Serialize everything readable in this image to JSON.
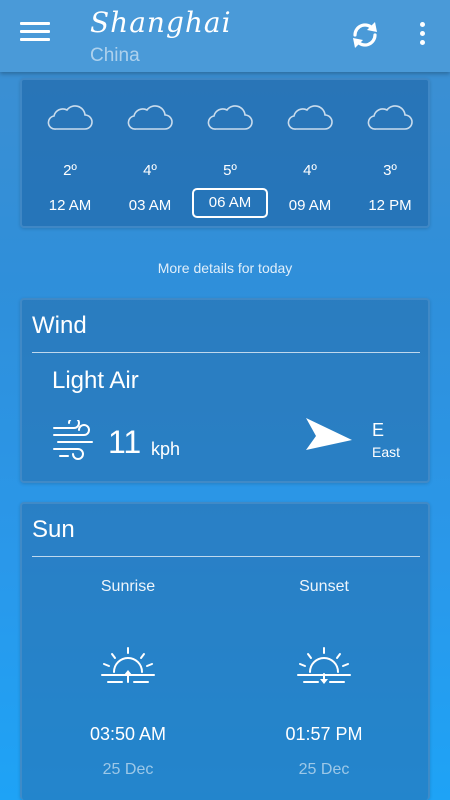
{
  "header": {
    "city": "Shanghai",
    "country": "China"
  },
  "hourly": [
    {
      "temp": "2º",
      "time": "12 AM",
      "icon": "cloud-icon"
    },
    {
      "temp": "4º",
      "time": "03 AM",
      "icon": "cloud-icon"
    },
    {
      "temp": "5º",
      "time": "06 AM",
      "icon": "cloud-icon",
      "selected": true
    },
    {
      "temp": "4º",
      "time": "09 AM",
      "icon": "cloud-icon"
    },
    {
      "temp": "3º",
      "time": "12 PM",
      "icon": "cloud-icon"
    }
  ],
  "more_details": "More details for today",
  "wind": {
    "title": "Wind",
    "description": "Light Air",
    "speed": "11",
    "unit": "kph",
    "direction": "E",
    "direction_name": "East"
  },
  "sun": {
    "title": "Sun",
    "sunrise": {
      "label": "Sunrise",
      "time": "03:50 AM",
      "date": "25 Dec"
    },
    "sunset": {
      "label": "Sunset",
      "time": "01:57 PM",
      "date": "25 Dec"
    }
  },
  "colors": {
    "appbar": "#4a9ad8",
    "card_border": "#468cc8",
    "background_top": "#3f8fd0",
    "background_bottom": "#1ea3f6"
  }
}
